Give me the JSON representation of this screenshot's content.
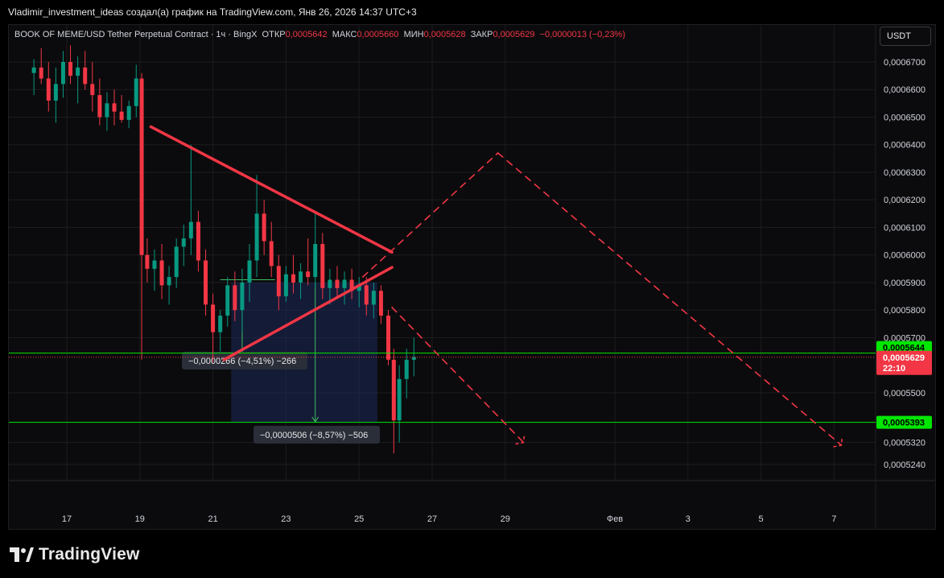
{
  "header": {
    "title": "Vladimir_investment_ideas создал(а) график на TradingView.com, Янв 26, 2026 14:37 UTC+3"
  },
  "legend": {
    "symbol": "BOOK OF MEME/USD Tether Perpetual Contract · 1ч · BingX",
    "open_label": "ОТКР",
    "open": "0,0005642",
    "high_label": "МАКС",
    "high": "0,0005660",
    "low_label": "МИН",
    "low": "0,0005628",
    "close_label": "ЗАКР",
    "close": "0,0005629",
    "change": "−0,0000013 (−0,23%)"
  },
  "currency_button": "USDT",
  "footer": {
    "brand": "TradingView"
  },
  "colors": {
    "background": "#0b0b0d",
    "up": "#089981",
    "down": "#f23645",
    "trendline": "#f23645",
    "level_line": "#00e600",
    "measure_fill": "#1e2a5a"
  },
  "chart_data": {
    "type": "candlestick",
    "timeframe": "1h",
    "y_ticks": [
      "0,0006700",
      "0,0006600",
      "0,0006500",
      "0,0006400",
      "0,0006300",
      "0,0006200",
      "0,0006100",
      "0,0006000",
      "0,0005900",
      "0,0005800",
      "0,0005700",
      "0,0005500",
      "0,0005320",
      "0,0005240"
    ],
    "x_ticks": [
      "17",
      "19",
      "21",
      "23",
      "25",
      "27",
      "29",
      "Фев",
      "3",
      "5",
      "7"
    ],
    "price_labels": {
      "level_high": "0,0005644",
      "current": "0,0005629",
      "countdown": "22:10",
      "level_low": "0,0005393"
    },
    "measurements": [
      {
        "text": "−0,0000266 (−4,51%) −266"
      },
      {
        "text": "−0,0000506 (−8,57%) −506"
      }
    ],
    "candles": [
      {
        "d": 16.1,
        "o": 0.000666,
        "h": 0.000671,
        "l": 0.000658,
        "c": 0.000668
      },
      {
        "d": 16.3,
        "o": 0.000668,
        "h": 0.000675,
        "l": 0.000662,
        "c": 0.000664
      },
      {
        "d": 16.5,
        "o": 0.000664,
        "h": 0.00067,
        "l": 0.000652,
        "c": 0.000656
      },
      {
        "d": 16.7,
        "o": 0.000656,
        "h": 0.000668,
        "l": 0.000648,
        "c": 0.000662
      },
      {
        "d": 16.9,
        "o": 0.000662,
        "h": 0.000674,
        "l": 0.000657,
        "c": 0.00067
      },
      {
        "d": 17.1,
        "o": 0.00067,
        "h": 0.000676,
        "l": 0.000662,
        "c": 0.000665
      },
      {
        "d": 17.3,
        "o": 0.000665,
        "h": 0.000672,
        "l": 0.000655,
        "c": 0.000668
      },
      {
        "d": 17.5,
        "o": 0.000668,
        "h": 0.000674,
        "l": 0.00066,
        "c": 0.000662
      },
      {
        "d": 17.7,
        "o": 0.000662,
        "h": 0.00067,
        "l": 0.000652,
        "c": 0.000658
      },
      {
        "d": 17.9,
        "o": 0.000658,
        "h": 0.000664,
        "l": 0.000647,
        "c": 0.00065
      },
      {
        "d": 18.1,
        "o": 0.00065,
        "h": 0.000659,
        "l": 0.000645,
        "c": 0.000655
      },
      {
        "d": 18.3,
        "o": 0.000655,
        "h": 0.00066,
        "l": 0.000647,
        "c": 0.000652
      },
      {
        "d": 18.5,
        "o": 0.000652,
        "h": 0.000658,
        "l": 0.000648,
        "c": 0.000649
      },
      {
        "d": 18.7,
        "o": 0.000649,
        "h": 0.000656,
        "l": 0.000646,
        "c": 0.000654
      },
      {
        "d": 18.9,
        "o": 0.000654,
        "h": 0.000669,
        "l": 0.00065,
        "c": 0.000664
      },
      {
        "d": 19.05,
        "o": 0.000664,
        "h": 0.000666,
        "l": 0.000562,
        "c": 0.0006
      },
      {
        "d": 19.2,
        "o": 0.0006,
        "h": 0.000606,
        "l": 0.00059,
        "c": 0.000595
      },
      {
        "d": 19.4,
        "o": 0.000595,
        "h": 0.000602,
        "l": 0.000587,
        "c": 0.000598
      },
      {
        "d": 19.6,
        "o": 0.000598,
        "h": 0.000604,
        "l": 0.000584,
        "c": 0.000589
      },
      {
        "d": 19.8,
        "o": 0.000589,
        "h": 0.000596,
        "l": 0.000582,
        "c": 0.000592
      },
      {
        "d": 20.0,
        "o": 0.000592,
        "h": 0.000606,
        "l": 0.000588,
        "c": 0.000603
      },
      {
        "d": 20.2,
        "o": 0.000603,
        "h": 0.000611,
        "l": 0.000596,
        "c": 0.000606
      },
      {
        "d": 20.4,
        "o": 0.000606,
        "h": 0.00064,
        "l": 0.0006,
        "c": 0.000612
      },
      {
        "d": 20.6,
        "o": 0.000612,
        "h": 0.000616,
        "l": 0.000594,
        "c": 0.000598
      },
      {
        "d": 20.8,
        "o": 0.000598,
        "h": 0.000602,
        "l": 0.000578,
        "c": 0.000582
      },
      {
        "d": 21.0,
        "o": 0.000582,
        "h": 0.000586,
        "l": 0.000561,
        "c": 0.000572
      },
      {
        "d": 21.2,
        "o": 0.000572,
        "h": 0.00058,
        "l": 0.000565,
        "c": 0.000578
      },
      {
        "d": 21.4,
        "o": 0.000578,
        "h": 0.000592,
        "l": 0.000574,
        "c": 0.000589
      },
      {
        "d": 21.6,
        "o": 0.000589,
        "h": 0.000594,
        "l": 0.000576,
        "c": 0.00058
      },
      {
        "d": 21.8,
        "o": 0.00058,
        "h": 0.000595,
        "l": 0.000572,
        "c": 0.00059
      },
      {
        "d": 22.0,
        "o": 0.00059,
        "h": 0.000604,
        "l": 0.000583,
        "c": 0.000598
      },
      {
        "d": 22.2,
        "o": 0.000598,
        "h": 0.000629,
        "l": 0.000592,
        "c": 0.000615
      },
      {
        "d": 22.4,
        "o": 0.000615,
        "h": 0.00062,
        "l": 0.0006,
        "c": 0.000605
      },
      {
        "d": 22.6,
        "o": 0.000605,
        "h": 0.000612,
        "l": 0.000592,
        "c": 0.000596
      },
      {
        "d": 22.8,
        "o": 0.000596,
        "h": 0.0006,
        "l": 0.00058,
        "c": 0.000585
      },
      {
        "d": 23.0,
        "o": 0.000585,
        "h": 0.000596,
        "l": 0.000583,
        "c": 0.000593
      },
      {
        "d": 23.2,
        "o": 0.000593,
        "h": 0.0006,
        "l": 0.000586,
        "c": 0.00059
      },
      {
        "d": 23.4,
        "o": 0.00059,
        "h": 0.000597,
        "l": 0.000584,
        "c": 0.000594
      },
      {
        "d": 23.6,
        "o": 0.000594,
        "h": 0.000606,
        "l": 0.000589,
        "c": 0.000592
      },
      {
        "d": 23.8,
        "o": 0.000592,
        "h": 0.000616,
        "l": 0.000588,
        "c": 0.000604
      },
      {
        "d": 24.0,
        "o": 0.000604,
        "h": 0.000608,
        "l": 0.000584,
        "c": 0.000588
      },
      {
        "d": 24.2,
        "o": 0.000588,
        "h": 0.000595,
        "l": 0.000582,
        "c": 0.000591
      },
      {
        "d": 24.4,
        "o": 0.000591,
        "h": 0.000596,
        "l": 0.000585,
        "c": 0.000588
      },
      {
        "d": 24.6,
        "o": 0.000588,
        "h": 0.000594,
        "l": 0.000582,
        "c": 0.000591
      },
      {
        "d": 24.8,
        "o": 0.000591,
        "h": 0.000595,
        "l": 0.000584,
        "c": 0.000587
      },
      {
        "d": 25.0,
        "o": 0.000587,
        "h": 0.000592,
        "l": 0.000581,
        "c": 0.000589
      },
      {
        "d": 25.2,
        "o": 0.000589,
        "h": 0.000592,
        "l": 0.000578,
        "c": 0.000582
      },
      {
        "d": 25.4,
        "o": 0.000582,
        "h": 0.00059,
        "l": 0.000577,
        "c": 0.000587
      },
      {
        "d": 25.6,
        "o": 0.000587,
        "h": 0.000589,
        "l": 0.000575,
        "c": 0.000578
      },
      {
        "d": 25.8,
        "o": 0.000578,
        "h": 0.00058,
        "l": 0.00056,
        "c": 0.000562
      },
      {
        "d": 25.95,
        "o": 0.000562,
        "h": 0.000566,
        "l": 0.000528,
        "c": 0.00054
      },
      {
        "d": 26.1,
        "o": 0.00054,
        "h": 0.00056,
        "l": 0.000532,
        "c": 0.000555
      },
      {
        "d": 26.3,
        "o": 0.000555,
        "h": 0.000566,
        "l": 0.000548,
        "c": 0.000562
      },
      {
        "d": 26.5,
        "o": 0.000562,
        "h": 0.00057,
        "l": 0.000556,
        "c": 0.000563
      }
    ],
    "drawings": {
      "upper_trendline": [
        {
          "d": 19.3,
          "p": 0.0006465
        },
        {
          "d": 25.9,
          "p": 0.000601
        }
      ],
      "lower_trendline": [
        {
          "d": 21.3,
          "p": 0.000562
        },
        {
          "d": 25.9,
          "p": 0.0005955
        }
      ],
      "projection_up": [
        {
          "d": 25.1,
          "p": 0.000592
        },
        {
          "d": 28.8,
          "p": 0.000637
        }
      ],
      "projection_down": [
        {
          "d": 28.8,
          "p": 0.000637
        },
        {
          "d": 7.2,
          "p": 0.000531
        }
      ],
      "target_short": [
        {
          "d": 25.9,
          "p": 0.000581
        },
        {
          "d": 29.5,
          "p": 0.000532
        }
      ],
      "levels": [
        0.0005644,
        0.0005393
      ]
    }
  }
}
